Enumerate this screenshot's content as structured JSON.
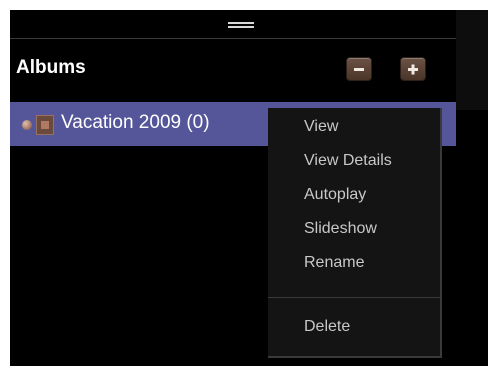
{
  "albums_panel": {
    "title": "Albums",
    "remove_button_icon": "minus-icon",
    "add_button_icon": "plus-icon",
    "album": {
      "label": "Vacation 2009 (0)",
      "icon": "album-icon"
    }
  },
  "context_menu": {
    "items": [
      "View",
      "View Details",
      "Autoplay",
      "Slideshow",
      "Rename"
    ],
    "danger_items": [
      "Delete"
    ]
  },
  "colors": {
    "panel_bg": "#000000",
    "selection_bg": "#55569a",
    "button_bg": "#5a4235",
    "menu_text": "#c8c8c8"
  }
}
